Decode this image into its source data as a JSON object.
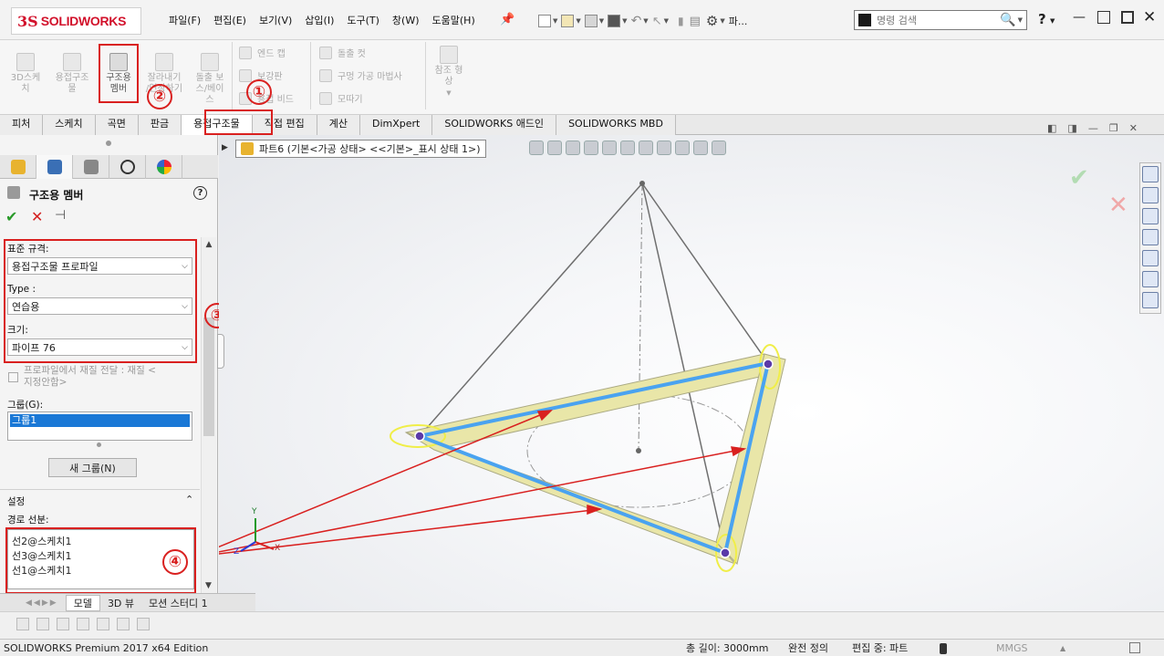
{
  "app": {
    "logo_prefix": "3S",
    "logo_text": "SOLIDWORKS"
  },
  "menu": [
    "파일(F)",
    "편집(E)",
    "보기(V)",
    "삽입(I)",
    "도구(T)",
    "창(W)",
    "도움말(H)"
  ],
  "toolbar": {
    "pa_label": "파...",
    "search_placeholder": "명령 검색",
    "help_label": "?"
  },
  "ribbon": {
    "buttons": [
      {
        "label": "3D스케\n치"
      },
      {
        "label": "용접구조\n물"
      },
      {
        "label": "구조용\n멤버"
      },
      {
        "label": "잘라내기\n/연장하기"
      },
      {
        "label": "돌출 보\n스/베이\n스"
      }
    ],
    "small_group1": [
      "엔드 캡",
      "보강판",
      "용접 비드"
    ],
    "small_group2": [
      "돌출 컷",
      "구멍 가공 마법사",
      "모따기"
    ],
    "ref_geom": "참조 형\n상"
  },
  "tabs": [
    "피처",
    "스케치",
    "곡면",
    "판금",
    "용접구조물",
    "직접 편집",
    "계산",
    "DimXpert",
    "SOLIDWORKS 애드인",
    "SOLIDWORKS MBD"
  ],
  "active_tab": "용접구조물",
  "property_manager": {
    "title": "구조용 멤버",
    "help": "?",
    "standard_label": "표준 규격:",
    "standard_value": "용접구조물 프로파일",
    "type_label": "Type :",
    "type_value": "연습용",
    "size_label": "크기:",
    "size_value": "파이프 76",
    "checkbox_label": "프로파일에서 재질 전달 : 재질 <\n지정안함>",
    "group_label": "그룹(G):",
    "group_items": [
      "그룹1"
    ],
    "new_group_button": "새 그룹(N)",
    "settings_header": "설정",
    "path_label": "경로 선분:",
    "path_items": [
      "선2@스케치1",
      "선3@스케치1",
      "선1@스케치1"
    ]
  },
  "annotations": [
    "①",
    "②",
    "③",
    "④"
  ],
  "viewport": {
    "breadcrumb": "파트6  (기본<가공 상태> <<기본>_표시 상태 1>)",
    "axis": {
      "x": "X",
      "y": "Y",
      "z": "Z"
    }
  },
  "model_tabs": [
    "모델",
    "3D 뷰",
    "모션 스터디 1"
  ],
  "status": {
    "edition": "SOLIDWORKS Premium 2017 x64 Edition",
    "length": "총 길이: 3000mm",
    "defined": "완전 정의",
    "editing": "편집 중: 파트",
    "units": "MMGS"
  },
  "colors": {
    "accent_red": "#d9201f",
    "member_fill": "#e9e6a8",
    "path_blue": "#4aa3f0",
    "logo_red": "#d2112b"
  }
}
